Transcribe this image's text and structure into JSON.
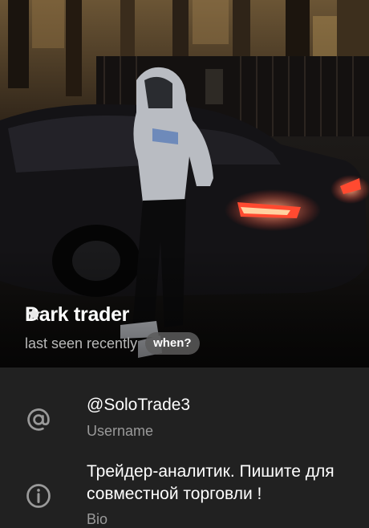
{
  "profile": {
    "name": "Dark trader",
    "status": "last seen recently",
    "when_button": "when?"
  },
  "info": {
    "username": "@SoloTrade3",
    "username_label": "Username",
    "bio": "Трейдер-аналитик. Пишите для совместной торговли !",
    "bio_label": "Bio"
  },
  "icons": {
    "star": "premium-star-icon",
    "username": "at-sign-icon",
    "bio": "info-icon"
  },
  "colors": {
    "background": "#212121",
    "secondary_text": "#9a9a9a",
    "taillight": "#ff3b2b"
  }
}
